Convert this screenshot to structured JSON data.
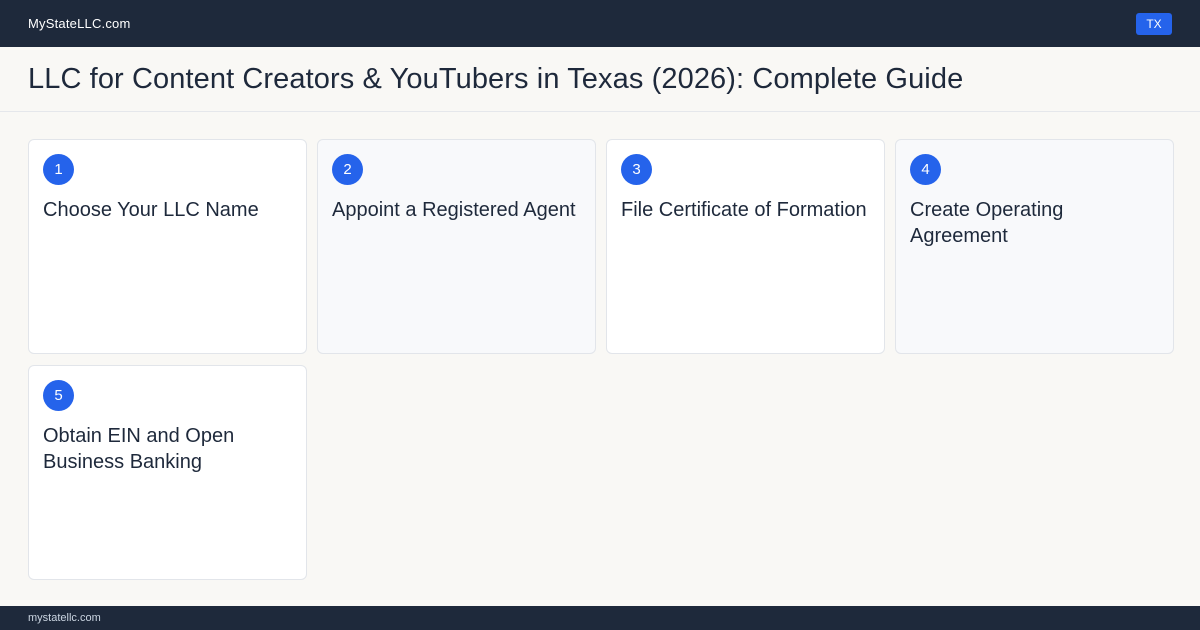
{
  "header": {
    "brand": "MyStateLLC.com",
    "state_badge": "TX"
  },
  "page": {
    "title": "LLC for Content Creators & YouTubers in Texas (2026): Complete Guide"
  },
  "steps": [
    {
      "number": "1",
      "title": "Choose Your LLC Name"
    },
    {
      "number": "2",
      "title": "Appoint a Registered Agent"
    },
    {
      "number": "3",
      "title": "File Certificate of Formation"
    },
    {
      "number": "4",
      "title": "Create Operating Agreement"
    },
    {
      "number": "5",
      "title": "Obtain EIN and Open Business Banking"
    }
  ],
  "footer": {
    "domain": "mystatellc.com"
  },
  "colors": {
    "navy": "#1e293b",
    "accent": "#2563eb",
    "page_bg": "#f9f8f5"
  }
}
